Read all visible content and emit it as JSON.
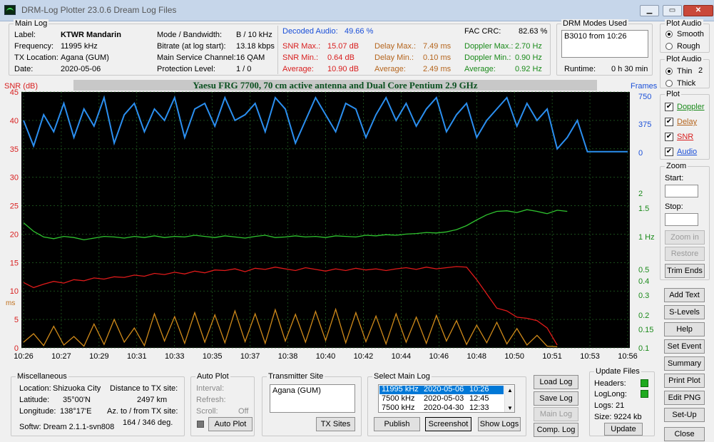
{
  "window": {
    "title": "DRM-Log Plotter 23.0.6    Dream Log Files",
    "btn_min": "▁",
    "btn_max": "▭",
    "btn_close": "✕"
  },
  "mainlog": {
    "group": "Main Log",
    "label_k": "Label:",
    "label_v": "KTWR  Mandarin",
    "freq_k": "Frequency:",
    "freq_v": "11995  kHz",
    "txloc_k": "TX Location:",
    "txloc_v": "Agana (GUM)",
    "date_k": "Date:",
    "date_v": "2020-05-06",
    "mode_k": "Mode / Bandwidth:",
    "mode_v": "B / 10 kHz",
    "bitrate_k": "Bitrate (at log start):",
    "bitrate_v": "13.18 kbps",
    "msc_k": "Main Service Channel:",
    "msc_v": "16  QAM",
    "prot_k": "Protection Level:",
    "prot_v": "1 / 0",
    "decoded_k": "Decoded Audio:",
    "decoded_v": "49.66 %",
    "fac_k": "FAC  CRC:",
    "fac_v": "82.63 %",
    "snrmax_k": "SNR Max.:",
    "snrmax_v": "15.07  dB",
    "snrmin_k": "SNR Min.:",
    "snrmin_v": "0.64  dB",
    "snravg_k": "Average:",
    "snravg_v": "10.90  dB",
    "dmax_k": "Delay Max.:",
    "dmax_v": "7.49   ms",
    "dmin_k": "Delay Min.:",
    "dmin_v": "0.10   ms",
    "davg_k": "Average:",
    "davg_v": "2.49   ms",
    "dopmax_k": "Doppler Max.:",
    "dopmax_v": "2.70 Hz",
    "dopmin_k": "Doppler Min.:",
    "dopmin_v": "0.90 Hz",
    "dopavg_k": "Average:",
    "dopavg_v": "0.92 Hz"
  },
  "drmmodes": {
    "group": "DRM Modes Used",
    "entry": "B3010 from 10:26",
    "runtime_k": "Runtime:",
    "runtime_v": "0 h 30 min"
  },
  "plotaudio": {
    "group": "Plot Audio",
    "smooth": "Smooth",
    "rough": "Rough"
  },
  "plotaudio2": {
    "group": "Plot Audio",
    "thin": "Thin",
    "thick": "Thick",
    "num": "2"
  },
  "plotopts": {
    "group": "Plot",
    "doppler": "Doppler",
    "delay": "Delay",
    "snr": "SNR",
    "audio": "Audio"
  },
  "zoom": {
    "group": "Zoom",
    "start": "Start:",
    "stop": "Stop:",
    "zoomin": "Zoom in",
    "restore": "Restore",
    "trim": "Trim Ends"
  },
  "side_buttons": {
    "addtext": "Add Text",
    "slevels": "S-Levels",
    "help": "Help",
    "setevent": "Set Event",
    "summary": "Summary",
    "printplot": "Print Plot",
    "editpng": "Edit PNG",
    "setup": "Set-Up",
    "close": "Close"
  },
  "chart_data": {
    "type": "line",
    "title": "Yaesu FRG 7700, 70 cm active antenna and Dual Core Pentium 2.9 GHz",
    "ylabel_left": "SNR (dB)",
    "ylabel_left2": "ms",
    "ylabel_right": "Frames",
    "y_left_ticks": [
      "45",
      "40",
      "35",
      "30",
      "25",
      "20",
      "15",
      "10",
      "5",
      "0"
    ],
    "y_right_frames_ticks": [
      "750",
      "375",
      "0"
    ],
    "y_right_doppler_ticks": [
      "2",
      "1.5",
      "1 Hz",
      "0.5",
      "0.4",
      "0.3",
      "0.2",
      "0.15",
      "0.1"
    ],
    "x_ticks": [
      "10:26",
      "10:27",
      "10:29",
      "10:31",
      "10:33",
      "10:35",
      "10:37",
      "10:38",
      "10:40",
      "10:42",
      "10:44",
      "10:46",
      "10:48",
      "10:50",
      "10:51",
      "10:53",
      "10:56"
    ],
    "colors": {
      "audio": "#2b8ff0",
      "doppler": "#2fc42f",
      "snr": "#e01a1a",
      "delay": "#d08a1a"
    },
    "series": [
      {
        "name": "Audio",
        "points": [
          [
            0,
            40
          ],
          [
            1,
            35.5
          ],
          [
            2,
            41
          ],
          [
            3,
            38
          ],
          [
            4,
            43
          ],
          [
            5,
            37
          ],
          [
            6,
            42
          ],
          [
            7,
            39
          ],
          [
            8,
            44
          ],
          [
            9,
            36
          ],
          [
            10,
            41
          ],
          [
            11,
            43
          ],
          [
            12,
            38
          ],
          [
            13,
            42
          ],
          [
            14,
            40
          ],
          [
            15,
            44
          ],
          [
            16,
            37
          ],
          [
            17,
            42
          ],
          [
            18,
            43
          ],
          [
            19,
            39
          ],
          [
            20,
            44
          ],
          [
            21,
            40
          ],
          [
            22,
            41
          ],
          [
            23,
            43
          ],
          [
            24,
            38
          ],
          [
            25,
            44
          ],
          [
            26,
            42
          ],
          [
            27,
            36
          ],
          [
            28,
            40
          ],
          [
            29,
            44
          ],
          [
            30,
            41
          ],
          [
            31,
            38
          ],
          [
            32,
            43
          ],
          [
            33,
            42
          ],
          [
            34,
            37
          ],
          [
            35,
            41
          ],
          [
            36,
            44
          ],
          [
            37,
            40
          ],
          [
            38,
            43
          ],
          [
            39,
            39
          ],
          [
            40,
            42
          ],
          [
            41,
            44
          ],
          [
            42,
            38
          ],
          [
            43,
            41
          ],
          [
            44,
            43
          ],
          [
            45,
            37
          ],
          [
            46,
            40
          ],
          [
            47,
            42
          ],
          [
            48,
            44
          ],
          [
            49,
            39
          ],
          [
            50,
            43
          ],
          [
            51,
            40
          ],
          [
            52,
            42
          ],
          [
            53,
            35
          ],
          [
            54,
            37
          ],
          [
            55,
            40
          ],
          [
            56,
            34.5
          ],
          [
            57,
            34.5
          ],
          [
            58,
            34.5
          ],
          [
            59,
            34.5
          ],
          [
            60,
            34.5
          ]
        ]
      },
      {
        "name": "Doppler",
        "points": [
          [
            0,
            22
          ],
          [
            1,
            20.5
          ],
          [
            2,
            19.5
          ],
          [
            3,
            19.2
          ],
          [
            4,
            19.6
          ],
          [
            5,
            19.4
          ],
          [
            6,
            19.0
          ],
          [
            7,
            19.3
          ],
          [
            8,
            19.6
          ],
          [
            9,
            19.5
          ],
          [
            10,
            19.3
          ],
          [
            11,
            19.6
          ],
          [
            12,
            19.4
          ],
          [
            13,
            19.7
          ],
          [
            14,
            19.4
          ],
          [
            15,
            19.6
          ],
          [
            16,
            19.5
          ],
          [
            17,
            19.8
          ],
          [
            18,
            19.6
          ],
          [
            19,
            19.4
          ],
          [
            20,
            19.7
          ],
          [
            21,
            19.5
          ],
          [
            22,
            19.3
          ],
          [
            23,
            19.6
          ],
          [
            24,
            19.8
          ],
          [
            25,
            19.4
          ],
          [
            26,
            19.5
          ],
          [
            27,
            19.7
          ],
          [
            28,
            19.5
          ],
          [
            29,
            19.6
          ],
          [
            30,
            19.4
          ],
          [
            31,
            19.7
          ],
          [
            32,
            19.6
          ],
          [
            33,
            19.5
          ],
          [
            34,
            19.8
          ],
          [
            35,
            19.7
          ],
          [
            36,
            19.9
          ],
          [
            37,
            19.8
          ],
          [
            38,
            20.0
          ],
          [
            39,
            20.1
          ],
          [
            40,
            20.3
          ],
          [
            41,
            20.2
          ],
          [
            42,
            20.4
          ],
          [
            43,
            20.8
          ],
          [
            44,
            21.5
          ],
          [
            45,
            22.5
          ],
          [
            46,
            23.4
          ],
          [
            47,
            24.0
          ],
          [
            48,
            24.1
          ],
          [
            49,
            23.8
          ],
          [
            50,
            24.3
          ],
          [
            51,
            24.0
          ],
          [
            52,
            23.6
          ],
          [
            53,
            24.2
          ],
          [
            54,
            24.0
          ]
        ]
      },
      {
        "name": "SNR",
        "points": [
          [
            0,
            11.5
          ],
          [
            1,
            10.6
          ],
          [
            2,
            11.2
          ],
          [
            3,
            11.7
          ],
          [
            4,
            11.4
          ],
          [
            5,
            12.0
          ],
          [
            6,
            11.8
          ],
          [
            7,
            12.3
          ],
          [
            8,
            12.1
          ],
          [
            9,
            12.5
          ],
          [
            10,
            12.4
          ],
          [
            11,
            12.8
          ],
          [
            12,
            12.6
          ],
          [
            13,
            13.1
          ],
          [
            14,
            12.9
          ],
          [
            15,
            13.3
          ],
          [
            16,
            13.0
          ],
          [
            17,
            13.5
          ],
          [
            18,
            13.2
          ],
          [
            19,
            13.7
          ],
          [
            20,
            13.6
          ],
          [
            21,
            13.9
          ],
          [
            22,
            13.4
          ],
          [
            23,
            14.0
          ],
          [
            24,
            13.8
          ],
          [
            25,
            14.2
          ],
          [
            26,
            13.9
          ],
          [
            27,
            13.6
          ],
          [
            28,
            14.1
          ],
          [
            29,
            13.8
          ],
          [
            30,
            13.5
          ],
          [
            31,
            13.9
          ],
          [
            32,
            13.6
          ],
          [
            33,
            14.0
          ],
          [
            34,
            13.7
          ],
          [
            35,
            13.9
          ],
          [
            36,
            13.6
          ],
          [
            37,
            13.9
          ],
          [
            38,
            14.1
          ],
          [
            39,
            13.8
          ],
          [
            40,
            14.2
          ],
          [
            41,
            13.9
          ],
          [
            42,
            14.1
          ],
          [
            43,
            14.3
          ],
          [
            44,
            14.2
          ],
          [
            45,
            12.0
          ],
          [
            46,
            9.5
          ],
          [
            47,
            7.0
          ],
          [
            48,
            6.5
          ],
          [
            49,
            5.4
          ],
          [
            50,
            5.2
          ],
          [
            51,
            4.8
          ],
          [
            52,
            3.5
          ],
          [
            53,
            0.5
          ]
        ]
      },
      {
        "name": "Delay",
        "points": [
          [
            0,
            1
          ],
          [
            1,
            2.5
          ],
          [
            2,
            0.4
          ],
          [
            3,
            3.8
          ],
          [
            4,
            0.5
          ],
          [
            5,
            2.0
          ],
          [
            6,
            0.3
          ],
          [
            7,
            4.2
          ],
          [
            8,
            0.6
          ],
          [
            9,
            5.0
          ],
          [
            10,
            1.0
          ],
          [
            11,
            3.5
          ],
          [
            12,
            0.4
          ],
          [
            13,
            6.0
          ],
          [
            14,
            1.2
          ],
          [
            15,
            5.5
          ],
          [
            16,
            0.8
          ],
          [
            17,
            6.2
          ],
          [
            18,
            1.0
          ],
          [
            19,
            5.8
          ],
          [
            20,
            0.9
          ],
          [
            21,
            6.5
          ],
          [
            22,
            1.1
          ],
          [
            23,
            6.0
          ],
          [
            24,
            0.8
          ],
          [
            25,
            6.7
          ],
          [
            26,
            1.2
          ],
          [
            27,
            5.9
          ],
          [
            28,
            1.0
          ],
          [
            29,
            6.4
          ],
          [
            30,
            1.3
          ],
          [
            31,
            6.8
          ],
          [
            32,
            0.9
          ],
          [
            33,
            6.2
          ],
          [
            34,
            1.1
          ],
          [
            35,
            5.6
          ],
          [
            36,
            0.7
          ],
          [
            37,
            6.0
          ],
          [
            38,
            1.0
          ],
          [
            39,
            5.4
          ],
          [
            40,
            0.8
          ],
          [
            41,
            5.7
          ],
          [
            42,
            1.2
          ],
          [
            43,
            4.8
          ],
          [
            44,
            0.6
          ],
          [
            45,
            4.0
          ],
          [
            46,
            0.9
          ],
          [
            47,
            4.5
          ],
          [
            48,
            0.7
          ],
          [
            49,
            3.4
          ],
          [
            50,
            0.5
          ],
          [
            51,
            2.2
          ],
          [
            52,
            0.3
          ],
          [
            53,
            0.2
          ]
        ]
      }
    ]
  },
  "misc": {
    "group": "Miscellaneous",
    "loc_k": "Location:",
    "loc_v": "Shizuoka City",
    "lat_k": "Latitude:",
    "lat_v": "35°00'N",
    "lon_k": "Longitude:",
    "lon_v": "138°17'E",
    "dist_k": "Distance to TX site:",
    "dist_v": "2497     km",
    "az_k": "Az. to / from TX site:",
    "az_v": "164 / 346  deg.",
    "softw": "Softw: Dream 2.1.1-svn808"
  },
  "autoplot": {
    "group": "Auto Plot",
    "interval": "Interval:",
    "refresh": "Refresh:",
    "scroll": "Scroll:",
    "scroll_v": "Off",
    "btn": "Auto Plot"
  },
  "txsite": {
    "group": "Transmitter Site",
    "value": "Agana (GUM)",
    "btn": "TX Sites"
  },
  "selectlog": {
    "group": "Select Main Log",
    "rows": [
      {
        "freq": "11995 kHz",
        "date": "2020-05-06",
        "time": "10:26"
      },
      {
        "freq": "7500 kHz",
        "date": "2020-05-03",
        "time": "12:45"
      },
      {
        "freq": "7500 kHz",
        "date": "2020-04-30",
        "time": "12:33"
      }
    ],
    "publish": "Publish",
    "screenshot": "Screenshot",
    "showlogs": "Show Logs"
  },
  "logbtns": {
    "load": "Load Log",
    "save": "Save Log",
    "main": "Main Log",
    "comp": "Comp. Log"
  },
  "updatefiles": {
    "group": "Update Files",
    "headers": "Headers:",
    "loglong": "LogLong:",
    "logs": "Logs: 21",
    "size": "Size:  9224 kb",
    "update": "Update"
  }
}
